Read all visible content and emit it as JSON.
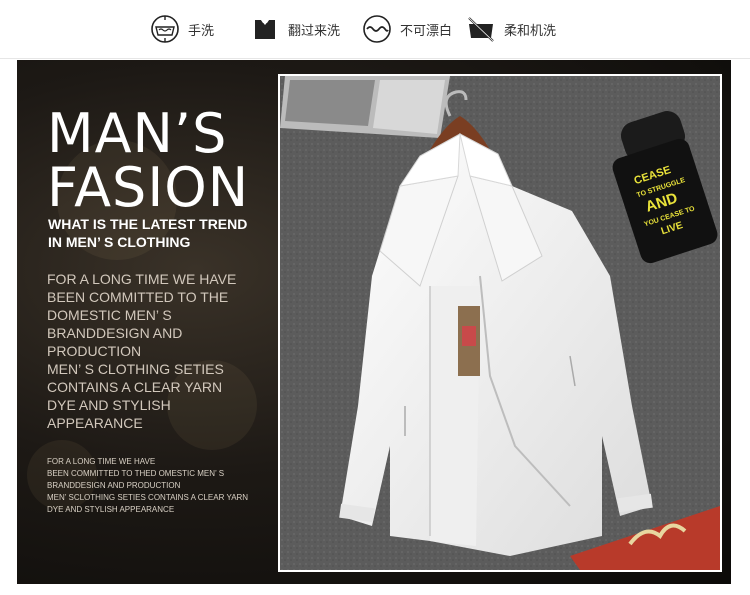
{
  "care_icons": [
    {
      "label": "手洗",
      "icon": "hand-wash-icon"
    },
    {
      "label": "翻过来洗",
      "icon": "turn-inside-out-icon"
    },
    {
      "label": "不可漂白",
      "icon": "no-bleach-icon"
    },
    {
      "label": "柔和机洗",
      "icon": "gentle-machine-wash-icon"
    }
  ],
  "headline": {
    "line1": "MAN’S",
    "line2": "FASION"
  },
  "subtitle": {
    "line1": "WHAT IS THE LATEST TREND",
    "line2": "IN MEN’ S CLOTHING"
  },
  "description": [
    "FOR A LONG TIME WE HAVE",
    "BEEN COMMITTED TO THE",
    "DOMESTIC MEN’ S",
    "BRANDDESIGN AND",
    "PRODUCTION",
    "MEN’ S CLOTHING SETIES",
    "CONTAINS A CLEAR YARN",
    "DYE AND STYLISH",
    "APPEARANCE"
  ],
  "small_text": [
    "FOR A LONG TIME WE HAVE",
    "BEEN COMMITTED TO THED OMESTIC MEN’ S",
    "BRANDDESIGN AND PRODUCTION",
    "MEN’ SCLOTHING SETIES CONTAINS A CLEAR YARN",
    "DYE AND STYLISH APPEARANCE"
  ],
  "bottle_text": [
    "CEASE",
    "TO STRUGGLE",
    "AND",
    "YOU CEASE TO",
    "LIVE"
  ],
  "colors": {
    "banner_dark": "#1d1915",
    "jacket": "#f4f4f4",
    "background_surface": "#5e5e5e",
    "text_light": "#d2c8bc"
  }
}
